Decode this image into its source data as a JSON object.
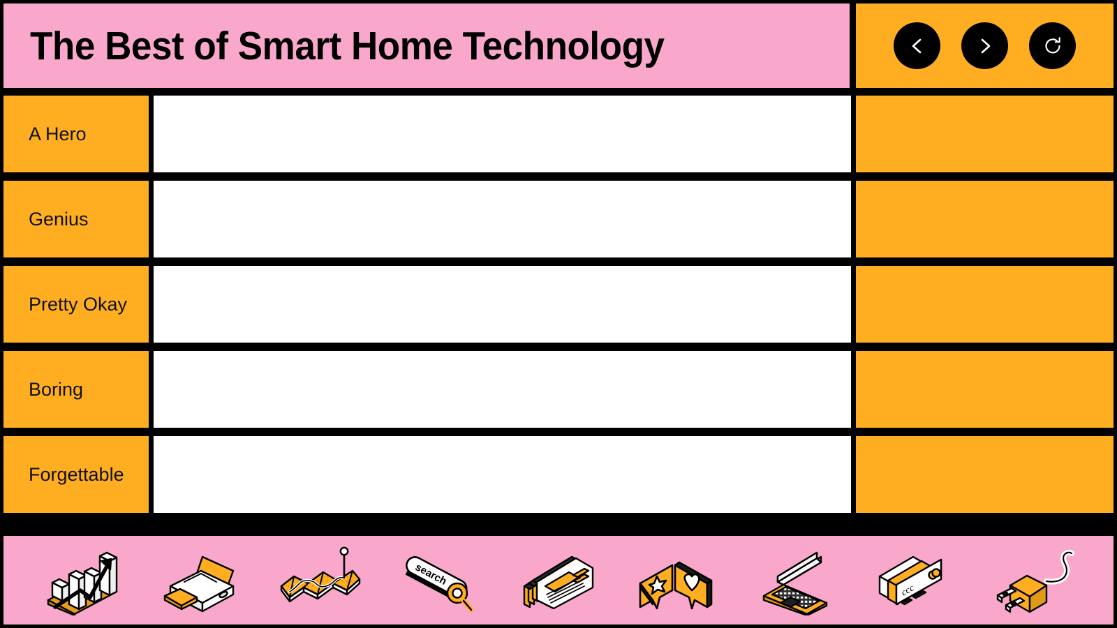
{
  "header": {
    "title": "The Best of Smart Home Technology",
    "nav_buttons": [
      {
        "name": "back-button",
        "icon": "chevron-left-icon",
        "label": "Back"
      },
      {
        "name": "forward-button",
        "icon": "chevron-right-icon",
        "label": "Forward"
      },
      {
        "name": "refresh-button",
        "icon": "refresh-icon",
        "label": "Refresh"
      }
    ]
  },
  "rows": [
    {
      "label": "A Hero",
      "content": "",
      "action": ""
    },
    {
      "label": "Genius",
      "content": "",
      "action": ""
    },
    {
      "label": "Pretty Okay",
      "content": "",
      "action": ""
    },
    {
      "label": "Boring",
      "content": "",
      "action": ""
    },
    {
      "label": "Forgettable",
      "content": "",
      "action": ""
    }
  ],
  "footer": {
    "icons": [
      {
        "name": "bar-chart-growth-icon",
        "label": "Analytics"
      },
      {
        "name": "printer-icon",
        "label": "Printer"
      },
      {
        "name": "map-pin-icon",
        "label": "Map"
      },
      {
        "name": "search-bar-icon",
        "label": "Search",
        "text": "search"
      },
      {
        "name": "webpage-stack-icon",
        "label": "Pages"
      },
      {
        "name": "speech-bubbles-icon",
        "label": "Reviews"
      },
      {
        "name": "laptop-icon",
        "label": "Laptop"
      },
      {
        "name": "credit-cards-icon",
        "label": "Payment",
        "text": "ccc"
      },
      {
        "name": "power-plug-icon",
        "label": "Power"
      }
    ]
  },
  "colors": {
    "pink": "#F9A8CC",
    "orange": "#FFAE21",
    "black": "#000000",
    "white": "#FFFFFF"
  }
}
